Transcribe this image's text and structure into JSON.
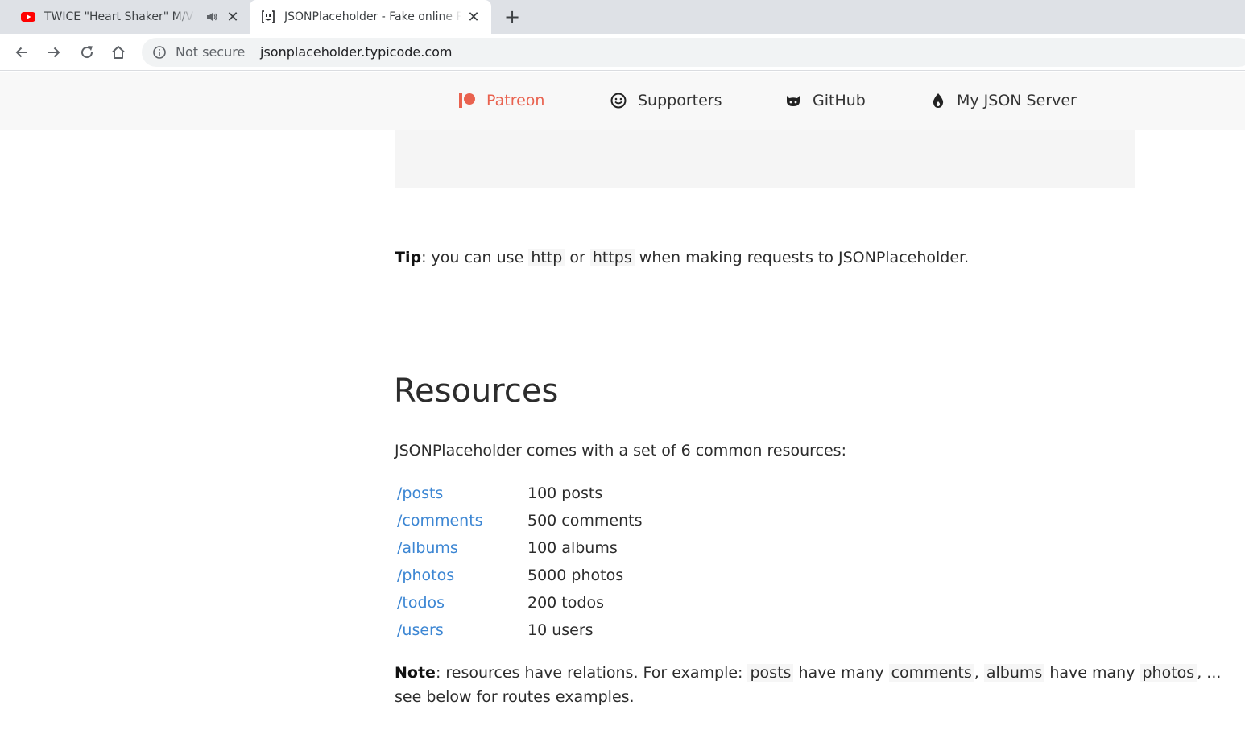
{
  "browser": {
    "tabs": [
      {
        "title": "TWICE \"Heart Shaker\" M/V - TWICE",
        "active": false,
        "audio": true
      },
      {
        "title": "JSONPlaceholder - Fake online REST API",
        "active": true
      }
    ],
    "omnibox": {
      "security_label": "Not secure",
      "url": "jsonplaceholder.typicode.com"
    }
  },
  "site_nav": {
    "items": [
      {
        "label": "Patreon",
        "icon": "patreon-icon",
        "color": "#e9624f"
      },
      {
        "label": "Supporters",
        "icon": "smile-icon"
      },
      {
        "label": "GitHub",
        "icon": "github-icon"
      },
      {
        "label": "My JSON Server",
        "icon": "flame-icon"
      }
    ]
  },
  "tip": {
    "bold": "Tip",
    "part1": ": you can use ",
    "code1": "http",
    "part2": " or ",
    "code2": "https",
    "part3": " when making requests to JSONPlaceholder."
  },
  "resources": {
    "heading": "Resources",
    "intro": "JSONPlaceholder comes with a set of 6 common resources:",
    "rows": [
      {
        "path": "/posts",
        "count": "100 posts"
      },
      {
        "path": "/comments",
        "count": "500 comments"
      },
      {
        "path": "/albums",
        "count": "100 albums"
      },
      {
        "path": "/photos",
        "count": "5000 photos"
      },
      {
        "path": "/todos",
        "count": "200 todos"
      },
      {
        "path": "/users",
        "count": "10 users"
      }
    ],
    "link_color": "#3c86d3"
  },
  "note": {
    "bold": "Note",
    "part1": ": resources have relations. For example: ",
    "code1": "posts",
    "part2": " have many ",
    "code2": "comments",
    "part3": ", ",
    "code3": "albums",
    "part4": " have many ",
    "code4": "photos",
    "part5": ", ...",
    "line2": "see below for routes examples."
  }
}
